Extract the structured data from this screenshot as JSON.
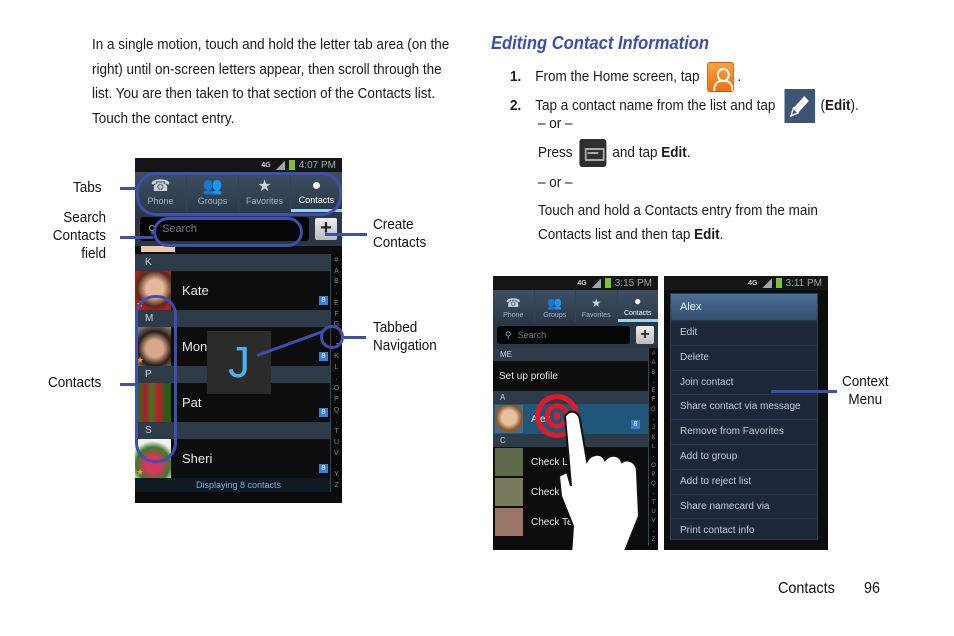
{
  "left_column": {
    "paragraph": "In a single motion, touch and hold the letter tab area (on the right) until on-screen letters appear, then scroll through the list. You are then taken to that section of the Contacts list. Touch the contact entry.",
    "phone": {
      "status": {
        "network": "4G",
        "time": "4:07 PM"
      },
      "tabs": [
        {
          "label": "Phone",
          "icon": "phone-icon"
        },
        {
          "label": "Groups",
          "icon": "groups-icon"
        },
        {
          "label": "Favorites",
          "icon": "star-icon"
        },
        {
          "label": "Contacts",
          "icon": "person-icon",
          "active": true
        }
      ],
      "search_placeholder": "Search",
      "add_label": "+",
      "sections": [
        {
          "header": "K",
          "name": "Kate",
          "favorite": true
        },
        {
          "header": "M",
          "name": "Mon",
          "favorite": true
        },
        {
          "header": "P",
          "name": "Pat",
          "favorite": false
        },
        {
          "header": "S",
          "name": "Sheri",
          "favorite": true
        }
      ],
      "index_letters": [
        "#",
        "A",
        "B",
        ".",
        "E",
        "F",
        "G",
        ".",
        "J",
        "K",
        "L",
        ".",
        "O",
        "P",
        "Q",
        ".",
        "T",
        "U",
        "V",
        ".",
        "Y",
        "Z"
      ],
      "popup_letter": "J",
      "footer": "Displaying 8 contacts"
    },
    "callouts": {
      "tabs": "Tabs",
      "search": [
        "Search",
        "Contacts",
        "field"
      ],
      "contacts": "Contacts",
      "create": [
        "Create",
        "Contacts"
      ],
      "tabbed": [
        "Tabbed",
        "Navigation"
      ]
    }
  },
  "right_column": {
    "title": "Editing Contact Information",
    "steps": {
      "s1_num": "1.",
      "s1_text": "From the Home screen, tap",
      "s1_end": ".",
      "s2_num": "2.",
      "s2_text": "Tap a contact name from the list and tap",
      "s2_paren_open": "(",
      "s2_edit": "Edit",
      "s2_paren_close": ").",
      "or1": "– or –",
      "press": "Press",
      "and_tap": "and tap",
      "edit": "Edit",
      "period": ".",
      "or2": "– or –",
      "touch_line1": "Touch and hold a Contacts entry from the main",
      "touch_line2": "Contacts list and then tap",
      "touch_edit": "Edit",
      "touch_end": "."
    },
    "phone_list": {
      "status": {
        "network": "4G",
        "time": "3:15 PM"
      },
      "tabs": [
        {
          "label": "Phone"
        },
        {
          "label": "Groups"
        },
        {
          "label": "Favorites"
        },
        {
          "label": "Contacts",
          "active": true
        }
      ],
      "search_placeholder": "Search",
      "me_header": "ME",
      "setup_profile": "Set up profile",
      "a_header": "A",
      "selected_contact": "Alex",
      "c_header": "C",
      "contacts_c": [
        "Check L",
        "Check",
        "Check Te"
      ],
      "index_letters": [
        "#",
        "A",
        "B",
        ".",
        "E",
        "F",
        "G",
        ".",
        "J",
        "K",
        "L",
        ".",
        "O",
        "P",
        "Q",
        ".",
        "T",
        "U",
        "V",
        ".",
        "Z"
      ]
    },
    "phone_menu": {
      "status": {
        "network": "4G",
        "time": "3:11 PM"
      },
      "menu_title": "Alex",
      "items": [
        "Edit",
        "Delete",
        "Join contact",
        "Share contact via message",
        "Remove from Favorites",
        "Add to group",
        "Add to reject list",
        "Share namecard via",
        "Print contact info"
      ]
    },
    "callout_context": [
      "Context",
      "Menu"
    ]
  },
  "footer": {
    "section": "Contacts",
    "page": "96"
  }
}
